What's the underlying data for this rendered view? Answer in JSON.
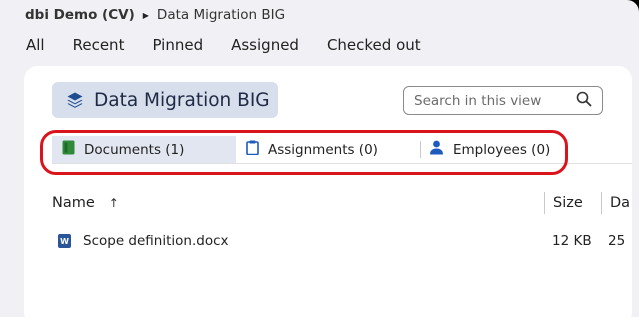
{
  "breadcrumb": {
    "root": "dbi Demo (CV)",
    "separator_icon": "caret-right-icon",
    "current": "Data Migration BIG"
  },
  "nav": {
    "items": [
      {
        "label": "All"
      },
      {
        "label": "Recent"
      },
      {
        "label": "Pinned"
      },
      {
        "label": "Assigned"
      },
      {
        "label": "Checked out"
      }
    ]
  },
  "view": {
    "title": "Data Migration BIG",
    "icon": "layers-stack-icon"
  },
  "search": {
    "placeholder": "Search in this view",
    "icon": "search-icon"
  },
  "tabs": [
    {
      "label": "Documents (1)",
      "icon": "document-icon",
      "icon_color": "#2e8b3a",
      "active": true
    },
    {
      "label": "Assignments (0)",
      "icon": "clipboard-icon",
      "icon_color": "#1e5bbf",
      "active": false
    },
    {
      "label": "Employees (0)",
      "icon": "person-icon",
      "icon_color": "#1e5bbf",
      "active": false
    }
  ],
  "table": {
    "columns": [
      {
        "label": "Name",
        "sort": "ascending",
        "sort_icon": "arrow-up-icon"
      },
      {
        "label": "Size"
      },
      {
        "label": "Da"
      }
    ],
    "rows": [
      {
        "name": "Scope definition.docx",
        "file_icon": "word-doc-icon",
        "size": "12 KB",
        "date": "25"
      }
    ]
  },
  "colors": {
    "accent_chip": "#d7deec",
    "active_tab": "#e1e6f0",
    "annotation_red": "#d9141c",
    "word_blue": "#2a5699"
  }
}
